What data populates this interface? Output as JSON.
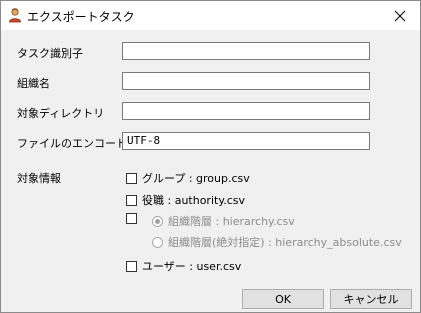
{
  "window": {
    "title": "エクスポートタスク"
  },
  "form": {
    "task_id": {
      "label": "タスク識別子",
      "value": ""
    },
    "org_name": {
      "label": "組織名",
      "value": ""
    },
    "target_dir": {
      "label": "対象ディレクトリ",
      "value": ""
    },
    "encoding": {
      "label": "ファイルのエンコード",
      "value": "UTF-8"
    }
  },
  "target_info": {
    "label": "対象情報",
    "group": {
      "label": "グループ : group.csv",
      "checked": false
    },
    "authority": {
      "label": "役職 : authority.csv",
      "checked": false
    },
    "org": {
      "checked": false
    },
    "hierarchy": {
      "label": "組織階層 : hierarchy.csv",
      "selected": true,
      "enabled": false
    },
    "hierarchy_absolute": {
      "label": "組織階層(絶対指定) : hierarchy_absolute.csv",
      "selected": false,
      "enabled": false
    },
    "user": {
      "label": "ユーザー : user.csv",
      "checked": false
    }
  },
  "buttons": {
    "ok": "OK",
    "cancel": "キャンセル"
  },
  "colors": {
    "accent_icon": "#d04a2a"
  }
}
